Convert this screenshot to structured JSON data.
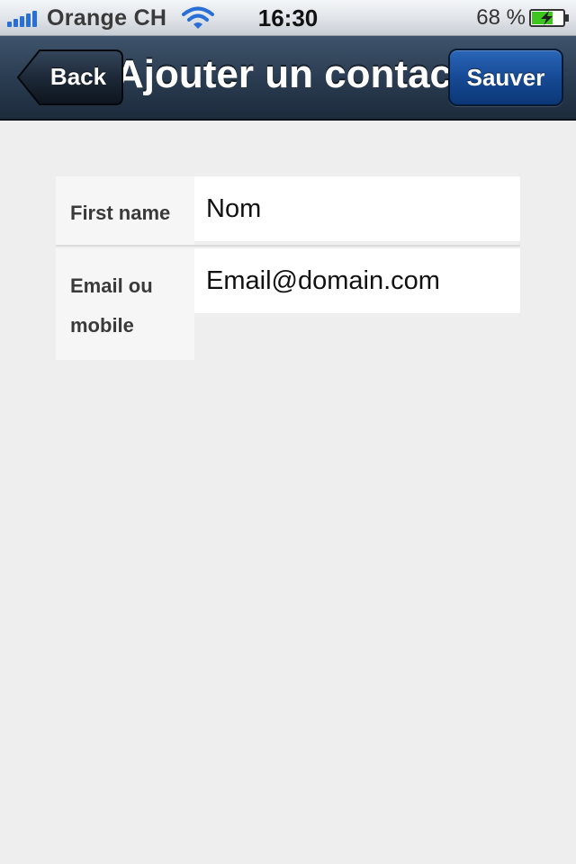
{
  "status_bar": {
    "carrier": "Orange CH",
    "time": "16:30",
    "battery_percent": "68 %",
    "signal_icon": "signal-bars-icon",
    "wifi_icon": "wifi-icon",
    "battery_icon": "battery-charging-icon",
    "battery_level": 0.68
  },
  "nav": {
    "title": "Ajouter un contact",
    "back_label": "Back",
    "save_label": "Sauver"
  },
  "form": {
    "fields": [
      {
        "label": "First name",
        "value": "Nom"
      },
      {
        "label": "Email ou mobile",
        "value": "Email@domain.com"
      }
    ]
  },
  "colors": {
    "nav_bar": "#2b3d52",
    "save_button": "#164a95",
    "background": "#eeeeee",
    "signal": "#2a6fd6",
    "battery_fill": "#3fc61e"
  }
}
